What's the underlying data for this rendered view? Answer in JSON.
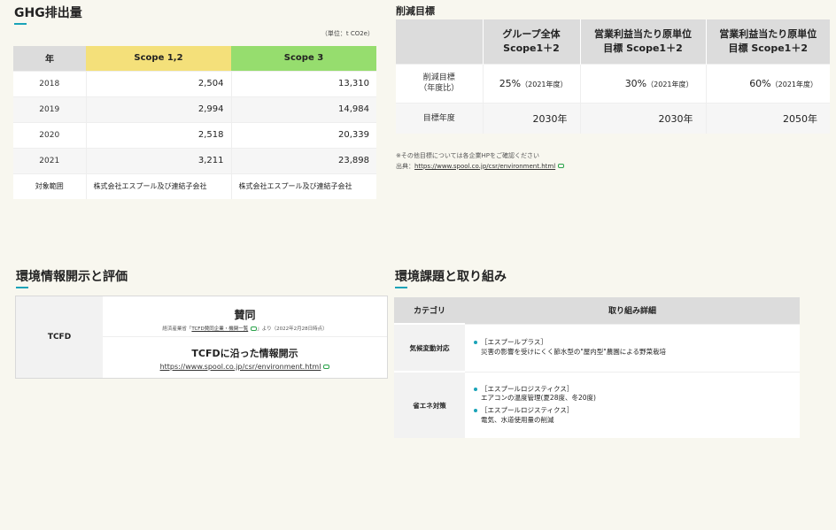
{
  "ghg": {
    "title": "GHG排出量",
    "unit": "（単位：t CO2e）",
    "headers": {
      "year": "年",
      "scope12": "Scope 1,2",
      "scope3": "Scope 3"
    },
    "rows": [
      {
        "year": "2018",
        "scope12": "2,504",
        "scope3": "13,310"
      },
      {
        "year": "2019",
        "scope12": "2,994",
        "scope3": "14,984"
      },
      {
        "year": "2020",
        "scope12": "2,518",
        "scope3": "20,339"
      },
      {
        "year": "2021",
        "scope12": "3,211",
        "scope3": "23,898"
      }
    ],
    "scope_row": {
      "label": "対象範囲",
      "scope12": "株式会社エスプール及び連結子会社",
      "scope3": "株式会社エスプール及び連結子会社"
    }
  },
  "reduction": {
    "title": "削減目標",
    "headers": {
      "col1": [
        "グループ全体",
        "Scope1＋2"
      ],
      "col2": [
        "営業利益当たり原単位",
        "目標 Scope1＋2"
      ],
      "col3": [
        "営業利益当たり原単位",
        "目標 Scope1＋2"
      ]
    },
    "row1": {
      "label": [
        "削減目標",
        "（年度比）"
      ],
      "v1": "25%",
      "v1s": "（2021年度）",
      "v2": "30%",
      "v2s": "（2021年度）",
      "v3": "60%",
      "v3s": "（2021年度）"
    },
    "row2": {
      "label": "目標年度",
      "v1": "2030年",
      "v2": "2030年",
      "v3": "2050年"
    },
    "note1": "※その他目標については各企業HPをご確認ください",
    "note2_prefix": "出典：",
    "note2_link": "https://www.spool.co.jp/csr/environment.html"
  },
  "disclosure": {
    "title": "環境情報開示と評価",
    "row_label": "TCFD",
    "support_title": "賛同",
    "support_note_prefix": "経済産業省「",
    "support_note_link": "TCFD賛同企業・機関一覧",
    "support_note_suffix": "」より（2022年2月28日時点）",
    "disclose_title": "TCFDに沿った情報開示",
    "disclose_link": "https://www.spool.co.jp/csr/environment.html"
  },
  "actions": {
    "title": "環境課題と取り組み",
    "headers": {
      "category": "カテゴリ",
      "detail": "取り組み詳細"
    },
    "rows": [
      {
        "category": "気候変動対応",
        "items": [
          {
            "head": "［エスプールプラス］",
            "body": "災害の影響を受けにくく節水型の\"屋内型\"農園による野菜栽培"
          }
        ]
      },
      {
        "category": "省エネ対策",
        "items": [
          {
            "head": "［エスプールロジスティクス］",
            "body": "エアコンの温度管理(夏28度、冬20度)"
          },
          {
            "head": "［エスプールロジスティクス］",
            "body": "電気、水道使用量の削減"
          }
        ]
      }
    ]
  }
}
